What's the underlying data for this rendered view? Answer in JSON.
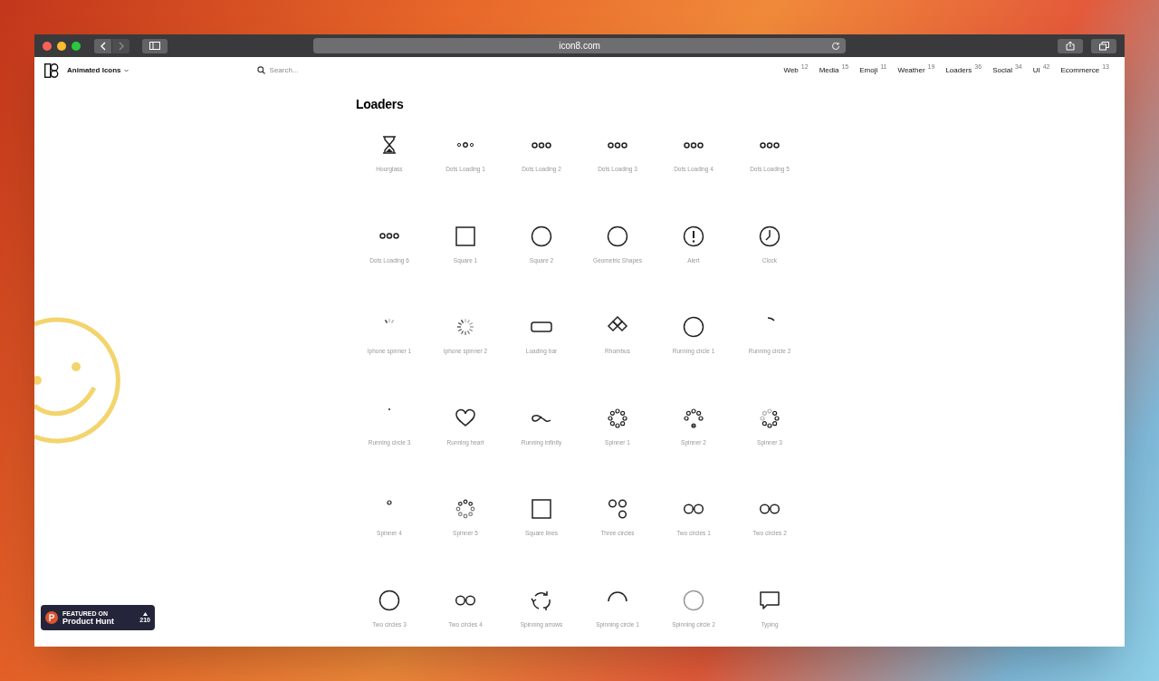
{
  "browser": {
    "url": "icon8.com"
  },
  "header": {
    "brand": "Animated Icons",
    "search": {
      "placeholder": "Search..."
    },
    "categories": [
      {
        "label": "Web",
        "count": "12",
        "selected": false
      },
      {
        "label": "Media",
        "count": "15",
        "selected": false
      },
      {
        "label": "Emoji",
        "count": "11",
        "selected": false
      },
      {
        "label": "Weather",
        "count": "19",
        "selected": false
      },
      {
        "label": "Loaders",
        "count": "36",
        "selected": false
      },
      {
        "label": "Social",
        "count": "34",
        "selected": false
      },
      {
        "label": "UI",
        "count": "42",
        "selected": false
      },
      {
        "label": "Ecommerce",
        "count": "13",
        "selected": false
      }
    ]
  },
  "section": {
    "title": "Loaders",
    "icons": [
      {
        "label": "Hourglass",
        "kind": "hourglass"
      },
      {
        "label": "Dots Loading 1",
        "kind": "dots-small"
      },
      {
        "label": "Dots Loading 2",
        "kind": "dots"
      },
      {
        "label": "Dots Loading 3",
        "kind": "dots"
      },
      {
        "label": "Dots Loading 4",
        "kind": "dots"
      },
      {
        "label": "Dots Loading 5",
        "kind": "dots"
      },
      {
        "label": "Dots Loading 6",
        "kind": "dots"
      },
      {
        "label": "Square 1",
        "kind": "square"
      },
      {
        "label": "Square 2",
        "kind": "circle"
      },
      {
        "label": "Geometric Shapes",
        "kind": "circle"
      },
      {
        "label": "Alert",
        "kind": "alert"
      },
      {
        "label": "Clock",
        "kind": "clock"
      },
      {
        "label": "Iphone spinner 1",
        "kind": "ticks-partial"
      },
      {
        "label": "Iphone spinner 2",
        "kind": "ticks"
      },
      {
        "label": "Loading bar",
        "kind": "bar"
      },
      {
        "label": "Rhombus",
        "kind": "rhombus"
      },
      {
        "label": "Running circle 1",
        "kind": "circle"
      },
      {
        "label": "Running circle 2",
        "kind": "arc-small"
      },
      {
        "label": "Running circle 3",
        "kind": "dash"
      },
      {
        "label": "Running heart",
        "kind": "heart"
      },
      {
        "label": "Running infinity",
        "kind": "infinity"
      },
      {
        "label": "Spinner 1",
        "kind": "ring-dots"
      },
      {
        "label": "Spinner 2",
        "kind": "ring-dots-partial"
      },
      {
        "label": "Spinner 3",
        "kind": "ring-dots-faded"
      },
      {
        "label": "Spinner 4",
        "kind": "single-dot"
      },
      {
        "label": "Spinner 5",
        "kind": "ring-dots-sparse"
      },
      {
        "label": "Square lines",
        "kind": "square"
      },
      {
        "label": "Three circles",
        "kind": "three-circles"
      },
      {
        "label": "Two circles 1",
        "kind": "two-circles"
      },
      {
        "label": "Two circles 2",
        "kind": "two-circles"
      },
      {
        "label": "Two circles 3",
        "kind": "circle"
      },
      {
        "label": "Two circles 4",
        "kind": "two-circles"
      },
      {
        "label": "Spinning arrows",
        "kind": "arrows"
      },
      {
        "label": "Spinning circle 1",
        "kind": "arc-top"
      },
      {
        "label": "Spinning circle 2",
        "kind": "circle-faded"
      },
      {
        "label": "Typing",
        "kind": "speech"
      }
    ]
  },
  "badge": {
    "kicker": "FEATURED ON",
    "name": "Product Hunt",
    "votes": "210"
  }
}
